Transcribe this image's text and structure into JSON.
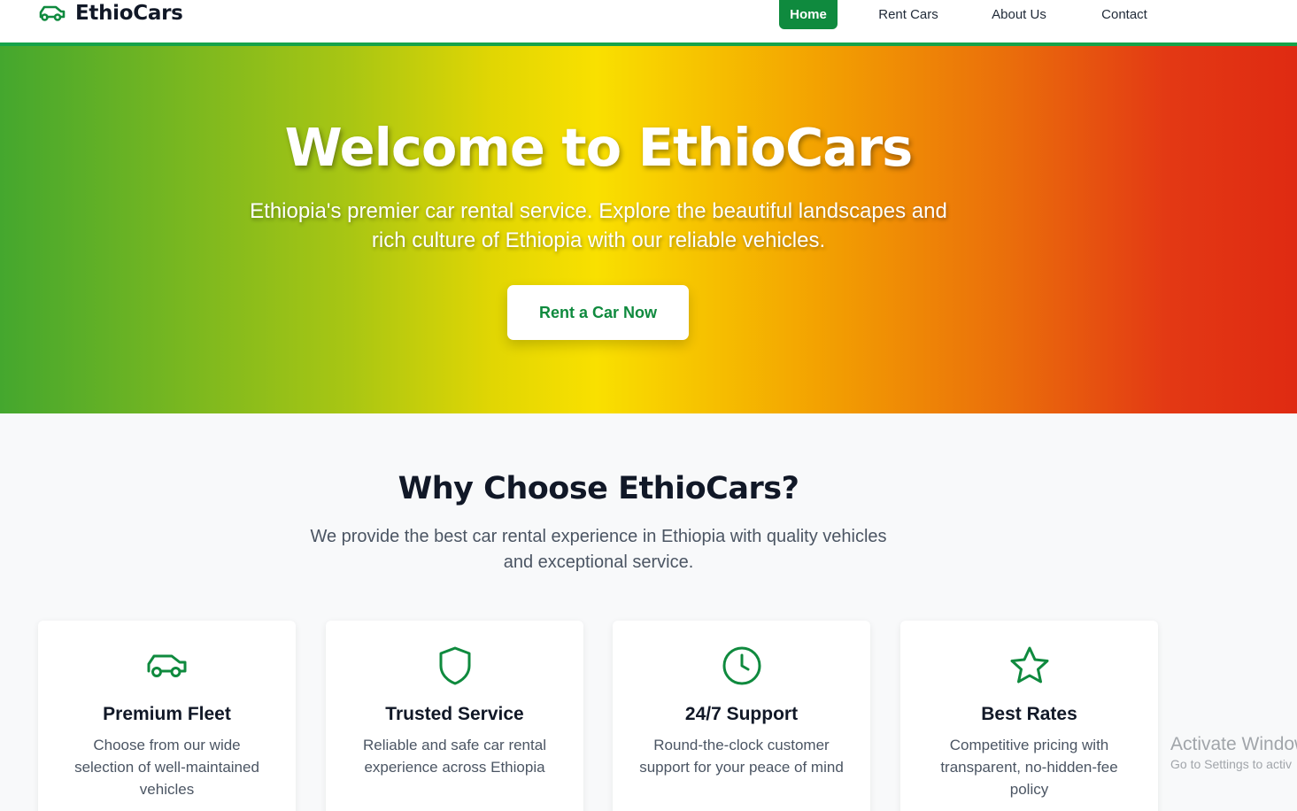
{
  "brand": {
    "name": "EthioCars",
    "icon": "car-icon"
  },
  "nav": {
    "items": [
      {
        "label": "Home",
        "active": true
      },
      {
        "label": "Rent Cars",
        "active": false
      },
      {
        "label": "About Us",
        "active": false
      },
      {
        "label": "Contact",
        "active": false
      }
    ]
  },
  "hero": {
    "title": "Welcome to EthioCars",
    "subtitle": "Ethiopia's premier car rental service. Explore the beautiful landscapes and rich culture of Ethiopia with our reliable vehicles.",
    "cta_label": "Rent a Car Now"
  },
  "why": {
    "title": "Why Choose EthioCars?",
    "subtitle": "We provide the best car rental experience in Ethiopia with quality vehicles and exceptional service."
  },
  "features": [
    {
      "icon": "car-icon",
      "title": "Premium Fleet",
      "text": "Choose from our wide selection of well-maintained vehicles"
    },
    {
      "icon": "shield-icon",
      "title": "Trusted Service",
      "text": "Reliable and safe car rental experience across Ethiopia"
    },
    {
      "icon": "clock-icon",
      "title": "24/7 Support",
      "text": "Round-the-clock customer support for your peace of mind"
    },
    {
      "icon": "star-icon",
      "title": "Best Rates",
      "text": "Competitive pricing with transparent, no-hidden-fee policy"
    }
  ],
  "watermark": {
    "title": "Activate Window",
    "subtitle": "Go to Settings to activ"
  },
  "colors": {
    "brand_green": "#0f8a3e",
    "accent_green": "#16a34a",
    "flag_green": "#44a72e",
    "flag_yellow": "#f9e000",
    "flag_red": "#df2a12"
  }
}
